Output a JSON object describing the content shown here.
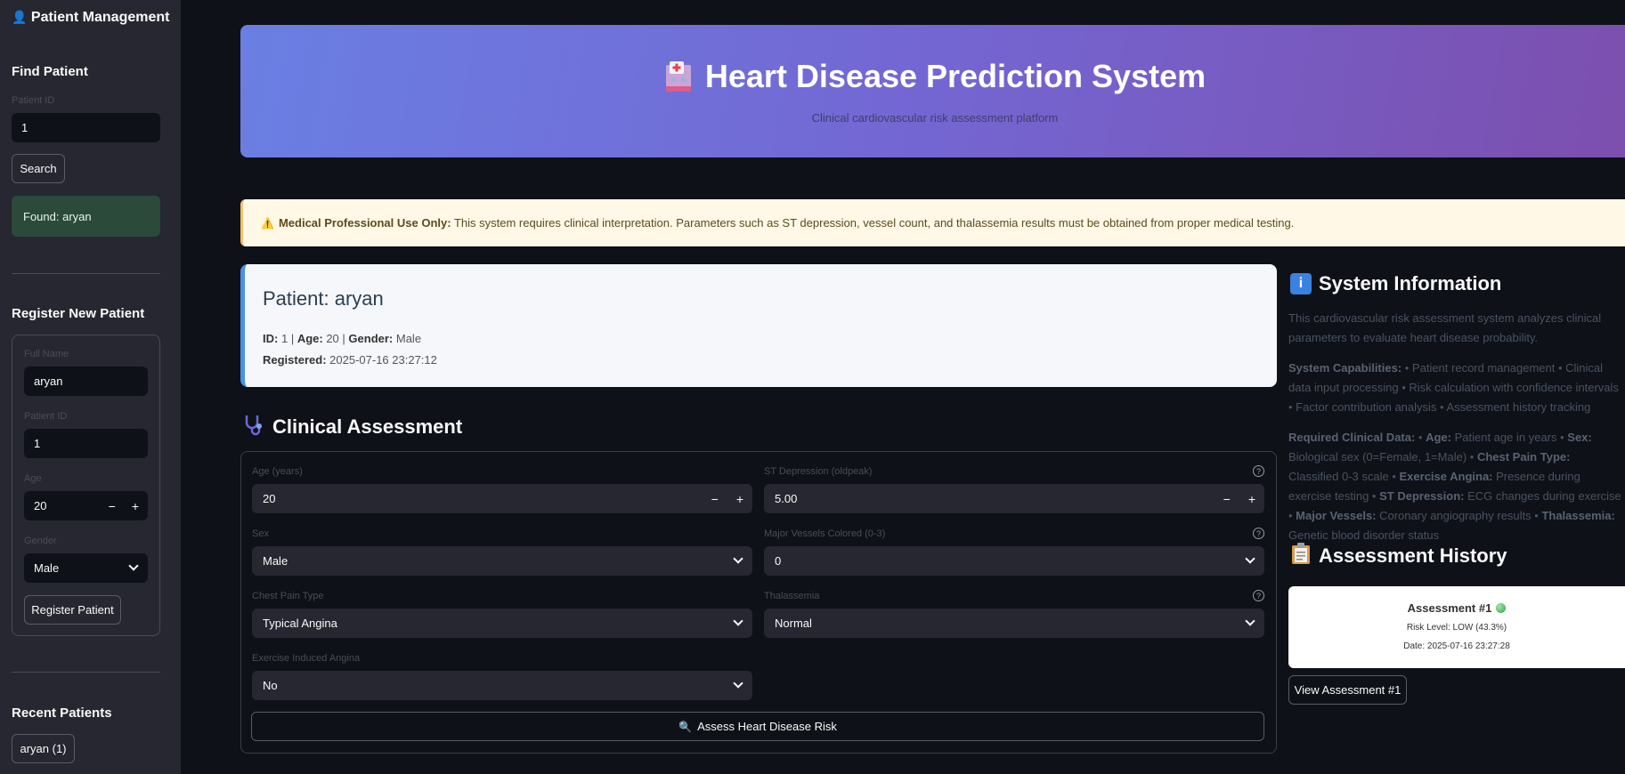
{
  "sidebar": {
    "title": "Patient Management",
    "find_heading": "Find Patient",
    "find_label": "Patient ID",
    "find_value": "1",
    "search_label": "Search",
    "found_text": "Found: aryan",
    "register_heading": "Register New Patient",
    "reg_name_label": "Full Name",
    "reg_name_value": "aryan",
    "reg_id_label": "Patient ID",
    "reg_id_value": "1",
    "reg_age_label": "Age",
    "reg_age_value": "20",
    "reg_gender_label": "Gender",
    "reg_gender_value": "Male",
    "register_button": "Register Patient",
    "recent_heading": "Recent Patients",
    "recent_items": [
      "aryan (1)"
    ]
  },
  "banner": {
    "title": "Heart Disease Prediction System",
    "subtitle": "Clinical cardiovascular risk assessment platform"
  },
  "warning": {
    "icon": "⚠️",
    "bold": "Medical Professional Use Only:",
    "text": " This system requires clinical interpretation. Parameters such as ST depression, vessel count, and thalassemia results must be obtained from proper medical testing."
  },
  "patient": {
    "heading": "Patient: aryan",
    "id_label": "ID:",
    "id_value": "1",
    "age_label": "Age:",
    "age_value": "20",
    "gender_label": "Gender:",
    "gender_value": "Male",
    "registered_label": "Registered:",
    "registered_value": "2025-07-16 23:27:12"
  },
  "assessment": {
    "heading": "Clinical Assessment",
    "age_label": "Age (years)",
    "age_value": "20",
    "st_label": "ST Depression (oldpeak)",
    "st_value": "5.00",
    "sex_label": "Sex",
    "sex_value": "Male",
    "vessels_label": "Major Vessels Colored (0-3)",
    "vessels_value": "0",
    "cp_label": "Chest Pain Type",
    "cp_value": "Typical Angina",
    "thal_label": "Thalassemia",
    "thal_value": "Normal",
    "exang_label": "Exercise Induced Angina",
    "exang_value": "No",
    "assess_button": "Assess Heart Disease Risk"
  },
  "system_info": {
    "heading": "System Information",
    "intro": "This cardiovascular risk assessment system analyzes clinical parameters to evaluate heart disease probability.",
    "cap_label": "System Capabilities:",
    "cap_text": " • Patient record management • Clinical data input processing • Risk calculation with confidence intervals • Factor contribution analysis • Assessment history tracking",
    "req_label": "Required Clinical Data:",
    "req_items": [
      {
        "label": "Age:",
        "text": " Patient age in years • "
      },
      {
        "label": "Sex:",
        "text": " Biological sex (0=Female, 1=Male) • "
      },
      {
        "label": "Chest Pain Type:",
        "text": " Classified 0-3 scale • "
      },
      {
        "label": "Exercise Angina:",
        "text": " Presence during exercise testing • "
      },
      {
        "label": "ST Depression:",
        "text": " ECG changes during exercise • "
      },
      {
        "label": "Major Vessels:",
        "text": " Coronary angiography results • "
      },
      {
        "label": "Thalassemia:",
        "text": " Genetic blood disorder status"
      }
    ]
  },
  "history": {
    "heading": "Assessment History",
    "card_title": "Assessment #1",
    "risk_line": "Risk Level: LOW (43.3%)",
    "date_line": "Date: 2025-07-16 23:27:28",
    "view_button": "View Assessment #1"
  }
}
